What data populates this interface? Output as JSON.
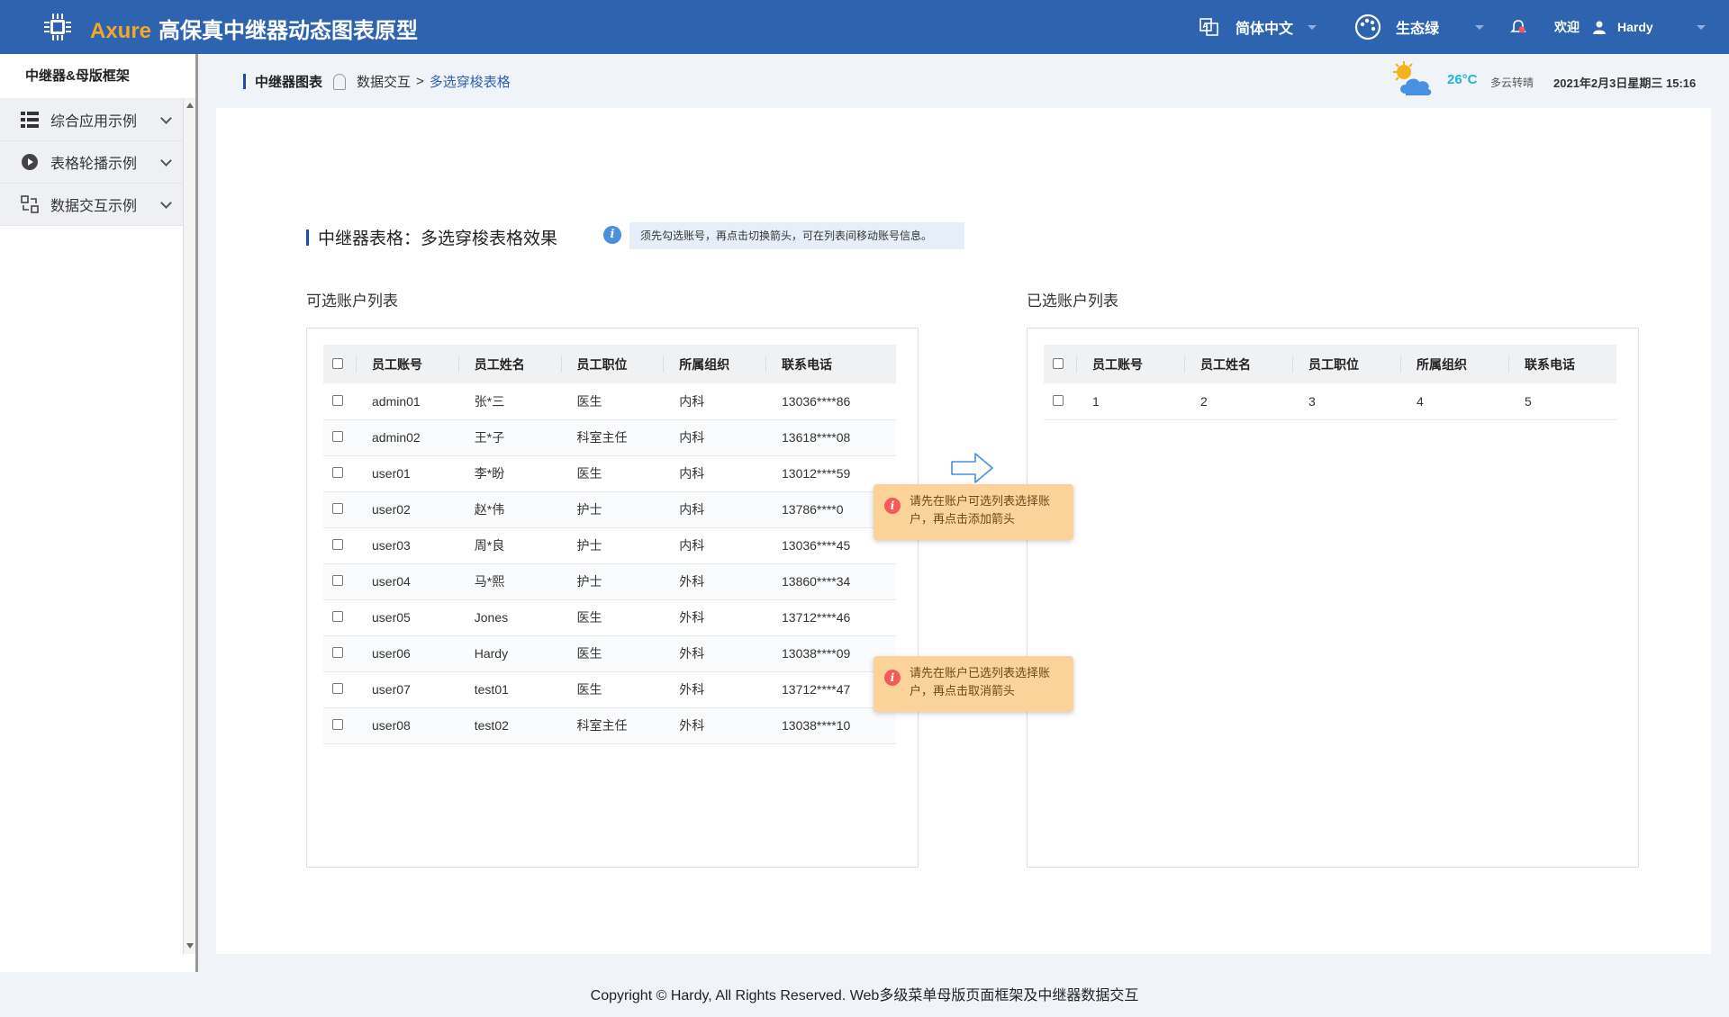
{
  "header": {
    "brand": "Axure",
    "title": "高保真中继器动态图表原型",
    "language": "简体中文",
    "theme": "生态绿",
    "welcome": "欢迎",
    "user": "Hardy"
  },
  "sidebar": {
    "title": "中继器&母版框架",
    "items": [
      {
        "label": "综合应用示例",
        "icon": "grid-list-icon"
      },
      {
        "label": "表格轮播示例",
        "icon": "play-circle-icon"
      },
      {
        "label": "数据交互示例",
        "icon": "exchange-icon"
      }
    ]
  },
  "breadcrumb": {
    "root": "中继器图表",
    "level2": "数据交互",
    "separator": ">",
    "current": "多选穿梭表格"
  },
  "status": {
    "temperature": "26°C",
    "weather": "多云转晴",
    "datetime": "2021年2月3日星期三 15:16"
  },
  "section": {
    "title": "中继器表格：多选穿梭表格效果",
    "hint": "须先勾选账号，再点击切换箭头，可在列表间移动账号信息。"
  },
  "available": {
    "title": "可选账户列表",
    "headers": [
      "员工账号",
      "员工姓名",
      "员工职位",
      "所属组织",
      "联系电话"
    ],
    "rows": [
      [
        "admin01",
        "张*三",
        "医生",
        "内科",
        "13036****86"
      ],
      [
        "admin02",
        "王*子",
        "科室主任",
        "内科",
        "13618****08"
      ],
      [
        "user01",
        "李*盼",
        "医生",
        "内科",
        "13012****59"
      ],
      [
        "user02",
        "赵*伟",
        "护士",
        "内科",
        "13786****0"
      ],
      [
        "user03",
        "周*良",
        "护士",
        "内科",
        "13036****45"
      ],
      [
        "user04",
        "马*熙",
        "护士",
        "外科",
        "13860****34"
      ],
      [
        "user05",
        "Jones",
        "医生",
        "外科",
        "13712****46"
      ],
      [
        "user06",
        "Hardy",
        "医生",
        "外科",
        "13038****09"
      ],
      [
        "user07",
        "test01",
        "医生",
        "外科",
        "13712****47"
      ],
      [
        "user08",
        "test02",
        "科室主任",
        "外科",
        "13038****10"
      ]
    ]
  },
  "selected": {
    "title": "已选账户列表",
    "headers": [
      "员工账号",
      "员工姓名",
      "员工职位",
      "所属组织",
      "联系电话"
    ],
    "rows": [
      [
        "1",
        "2",
        "3",
        "4",
        "5"
      ]
    ]
  },
  "tooltips": {
    "add": "请先在账户可选列表选择账户，再点击添加箭头",
    "remove": "请先在账户已选列表选择账户，再点击取消箭头"
  },
  "footer": "Copyright © Hardy, All Rights Reserved.  Web多级菜单母版页面框架及中继器数据交互",
  "colors": {
    "header_bg": "#2e63b0",
    "brand": "#f5a623",
    "accent": "#1e4fa8",
    "tooltip_bg": "#fbd29a",
    "temperature": "#1fb6d9"
  }
}
